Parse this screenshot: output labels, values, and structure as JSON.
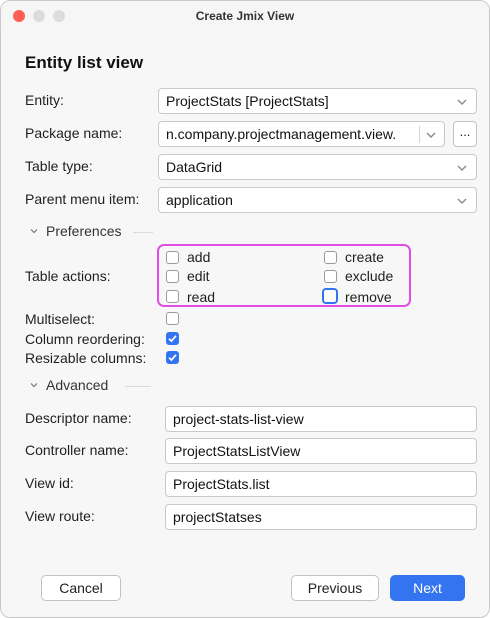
{
  "window": {
    "title": "Create Jmix View"
  },
  "heading": "Entity list view",
  "entity": {
    "label": "Entity:",
    "value": "ProjectStats [ProjectStats]"
  },
  "package": {
    "label": "Package name:",
    "value": "n.company.projectmanagement.view.",
    "browse_label": "..."
  },
  "table_type": {
    "label": "Table type:",
    "value": "DataGrid"
  },
  "parent_menu": {
    "label": "Parent menu item:",
    "value": "application"
  },
  "preferences": {
    "title": "Preferences",
    "table_actions_label": "Table actions:",
    "actions": [
      {
        "label": "add",
        "checked": false
      },
      {
        "label": "create",
        "checked": false
      },
      {
        "label": "edit",
        "checked": false
      },
      {
        "label": "exclude",
        "checked": false
      },
      {
        "label": "read",
        "checked": false
      },
      {
        "label": "remove",
        "checked": false
      }
    ],
    "multiselect_label": "Multiselect:",
    "multiselect_checked": false,
    "column_reordering_label": "Column reordering:",
    "column_reordering_checked": true,
    "resizable_columns_label": "Resizable columns:",
    "resizable_columns_checked": true
  },
  "advanced": {
    "title": "Advanced",
    "descriptor_label": "Descriptor name:",
    "descriptor_value": "project-stats-list-view",
    "controller_label": "Controller name:",
    "controller_value": "ProjectStatsListView",
    "view_id_label": "View id:",
    "view_id_value": "ProjectStats.list",
    "route_label": "View route:",
    "route_value": "projectStatses"
  },
  "buttons": {
    "cancel": "Cancel",
    "previous": "Previous",
    "next": "Next"
  },
  "colors": {
    "accent": "#3574f0",
    "highlight": "#e14ee3",
    "close": "#ff5f57"
  }
}
